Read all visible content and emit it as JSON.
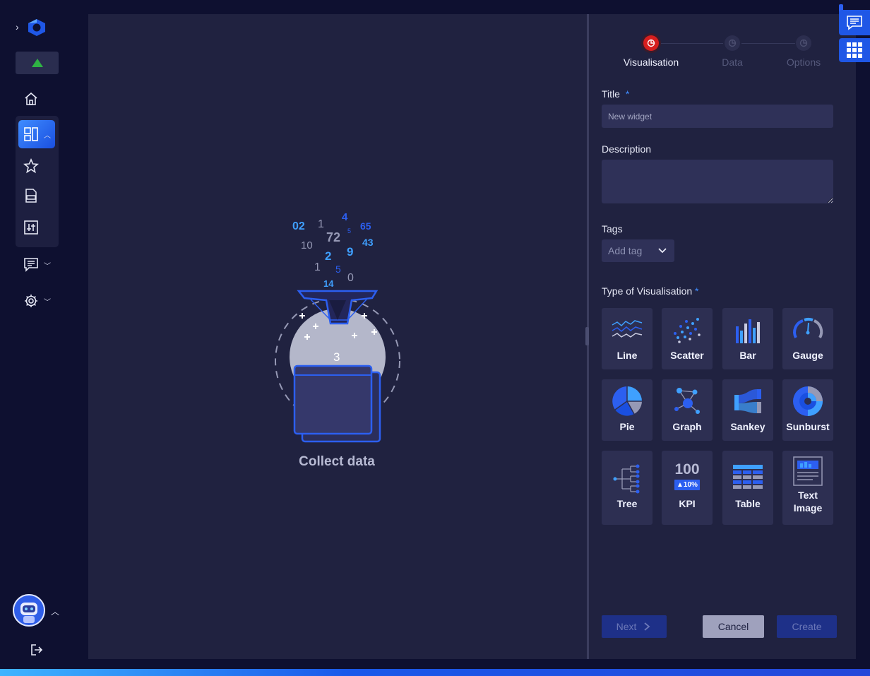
{
  "collect": {
    "label": "Collect data",
    "numbers": [
      "02",
      "1",
      "4",
      "65",
      "5",
      "72",
      "10",
      "43",
      "2",
      "9",
      "1",
      "5",
      "0",
      "14"
    ],
    "result": "3"
  },
  "wizard": {
    "steps": [
      {
        "label": "Visualisation",
        "state": "active"
      },
      {
        "label": "Data",
        "state": "inactive"
      },
      {
        "label": "Options",
        "state": "inactive"
      }
    ],
    "title_label": "Title",
    "required_marker": "*",
    "title_placeholder": "New widget",
    "description_label": "Description",
    "description_value": "",
    "tags_label": "Tags",
    "add_tag_label": "Add tag",
    "type_label": "Type of Visualisation",
    "types": [
      {
        "label": "Line",
        "icon": "line-chart-icon"
      },
      {
        "label": "Scatter",
        "icon": "scatter-chart-icon"
      },
      {
        "label": "Bar",
        "icon": "bar-chart-icon"
      },
      {
        "label": "Gauge",
        "icon": "gauge-icon"
      },
      {
        "label": "Pie",
        "icon": "pie-chart-icon"
      },
      {
        "label": "Graph",
        "icon": "graph-network-icon"
      },
      {
        "label": "Sankey",
        "icon": "sankey-icon"
      },
      {
        "label": "Sunburst",
        "icon": "sunburst-icon"
      },
      {
        "label": "Tree",
        "icon": "tree-icon"
      },
      {
        "label": "KPI",
        "icon": "kpi-icon",
        "kpi_value": "100",
        "kpi_delta": "▲10%"
      },
      {
        "label": "Table",
        "icon": "table-icon"
      },
      {
        "label": "Text Image",
        "icon": "text-image-icon"
      }
    ],
    "buttons": {
      "next": "Next",
      "cancel": "Cancel",
      "create": "Create"
    }
  },
  "colors": {
    "accent": "#3f8cff",
    "active_step": "#d61e1e",
    "background": "#202240",
    "sidebar": "#0e1030"
  }
}
